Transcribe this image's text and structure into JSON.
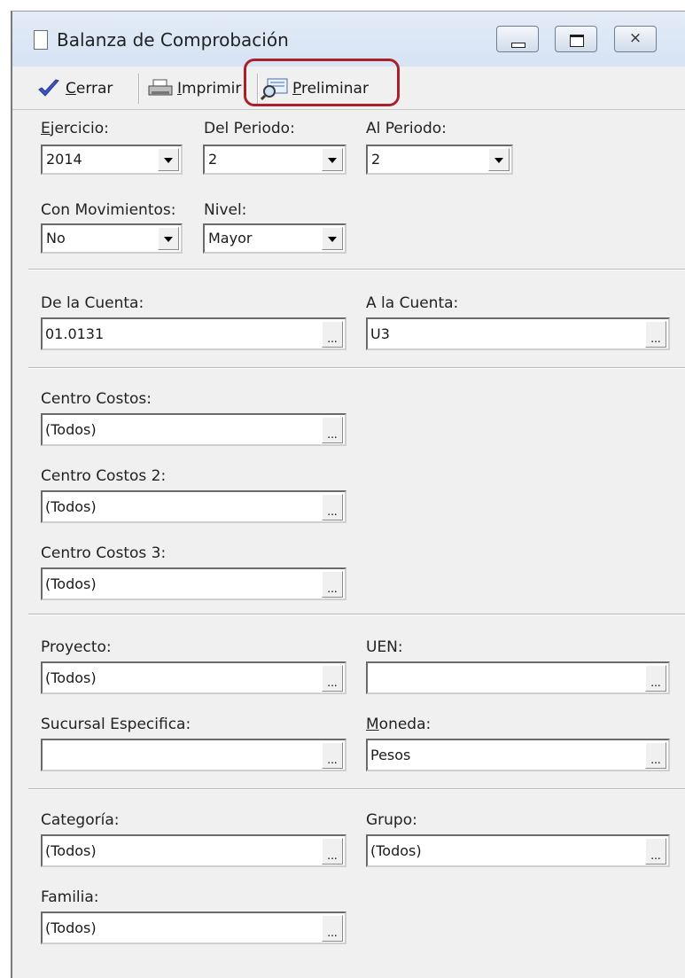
{
  "window": {
    "title": "Balanza de Comprobación",
    "close_glyph": "⨯"
  },
  "toolbar": {
    "close_label": "Cerrar",
    "print_label": "Imprimir",
    "preview_label": "Preliminar",
    "close_icon": "check-icon",
    "print_icon": "printer-icon",
    "preview_icon": "preview-icon",
    "highlight_color": "#a8202c"
  },
  "period": {
    "ejercicio_label": "Ejercicio:",
    "ejercicio_value": "2014",
    "del_periodo_label": "Del Periodo:",
    "del_periodo_value": "2",
    "al_periodo_label": "Al Periodo:",
    "al_periodo_value": "2",
    "movimientos_label": "Con Movimientos:",
    "movimientos_value": "No",
    "nivel_label": "Nivel:",
    "nivel_value": "Mayor"
  },
  "cuentas": {
    "de_label": "De la Cuenta:",
    "de_value": "01.0131",
    "a_label": "A la Cuenta:",
    "a_value": "U3"
  },
  "centros": {
    "cc1_label": "Centro Costos:",
    "cc1_value": "(Todos)",
    "cc2_label": "Centro Costos 2:",
    "cc2_value": "(Todos)",
    "cc3_label": "Centro Costos 3:",
    "cc3_value": "(Todos)"
  },
  "otros": {
    "proyecto_label": "Proyecto:",
    "proyecto_value": "(Todos)",
    "uen_label": "UEN:",
    "uen_value": "",
    "sucursal_label": "Sucursal Especifica:",
    "sucursal_value": "",
    "moneda_label": "Moneda:",
    "moneda_value": "Pesos"
  },
  "clasificacion": {
    "categoria_label": "Categoría:",
    "categoria_value": "(Todos)",
    "grupo_label": "Grupo:",
    "grupo_value": "(Todos)",
    "familia_label": "Familia:",
    "familia_value": "(Todos)"
  },
  "ellipsis": "..."
}
